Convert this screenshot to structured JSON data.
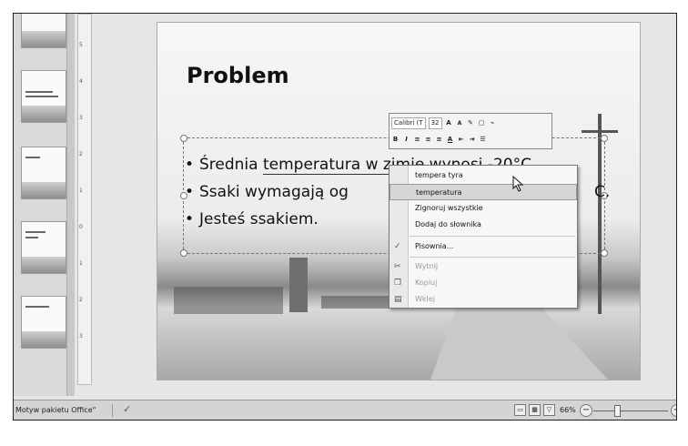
{
  "slide": {
    "title": "Problem",
    "bullets": [
      {
        "before": "Średnia ",
        "underlined": "temperatura w zimie wynosi",
        "after": " -20°C."
      },
      {
        "before": "Ssaki wymagają og",
        "underlined": "",
        "after": ""
      },
      {
        "before": "Jesteś ssakiem.",
        "underlined": "",
        "after": ""
      }
    ],
    "bullet2_tail": "C."
  },
  "mini_toolbar": {
    "font_name": "Calibri (T",
    "font_size": "32",
    "grow_font": "A",
    "shrink_font": "A",
    "bold": "B",
    "italic": "I",
    "font_color": "A"
  },
  "context_menu": {
    "items": [
      {
        "label": "tempera tyra",
        "state": "normal"
      },
      {
        "label": "temperatura",
        "state": "highlighted"
      },
      {
        "label": "Zignoruj wszystkie",
        "state": "normal"
      },
      {
        "label": "Dodaj do słownika",
        "state": "normal"
      },
      {
        "label": "Pisownia...",
        "state": "normal",
        "icon": "spelling-icon"
      },
      {
        "label": "Wytnij",
        "state": "disabled",
        "icon": "cut-icon"
      },
      {
        "label": "Kopiuj",
        "state": "disabled",
        "icon": "copy-icon"
      },
      {
        "label": "Wklej",
        "state": "disabled",
        "icon": "paste-icon"
      }
    ]
  },
  "status_bar": {
    "theme": "Motyw pakietu Office\"",
    "zoom": "66%",
    "zoom_level_percent": 66
  }
}
